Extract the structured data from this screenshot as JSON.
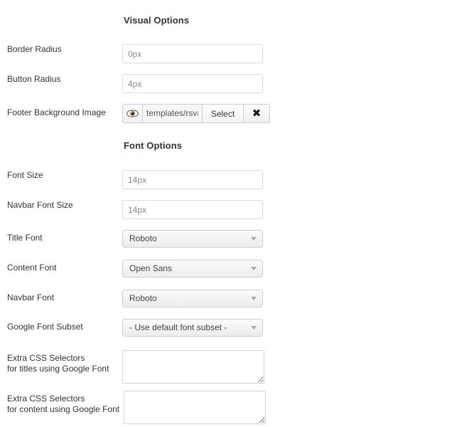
{
  "sections": {
    "visual": {
      "heading": "Visual Options"
    },
    "font": {
      "heading": "Font Options"
    }
  },
  "fields": {
    "border_radius": {
      "label": "Border Radius",
      "value": "0px",
      "placeholder": "0px"
    },
    "button_radius": {
      "label": "Button Radius",
      "value": "4px",
      "placeholder": "4px"
    },
    "footer_background_image": {
      "label": "Footer Background Image",
      "path_value": "templates/rsval",
      "preview_icon": "eye-icon",
      "select_label": "Select",
      "clear_icon": "x-icon",
      "clear_label": "✖"
    },
    "font_size": {
      "label": "Font Size",
      "value": "14px",
      "placeholder": "14px"
    },
    "navbar_font_size": {
      "label": "Navbar Font Size",
      "value": "14px",
      "placeholder": "14px"
    },
    "title_font": {
      "label": "Title Font",
      "value": "Roboto"
    },
    "content_font": {
      "label": "Content Font",
      "value": "Open Sans"
    },
    "navbar_font": {
      "label": "Navbar Font",
      "value": "Roboto"
    },
    "google_font_subset": {
      "label": "Google Font Subset",
      "value": "- Use default font subset -"
    },
    "extra_css_titles": {
      "label_line1": "Extra CSS Selectors",
      "label_line2": "for titles using Google Font",
      "value": ""
    },
    "extra_css_content": {
      "label_line1": "Extra CSS Selectors",
      "label_line2": "for content using Google Font",
      "value": ""
    }
  },
  "colors": {
    "text": "#333333",
    "input_text": "#888888",
    "border": "#d9d9d9",
    "select_border": "#cccccc",
    "background": "#ffffff"
  }
}
